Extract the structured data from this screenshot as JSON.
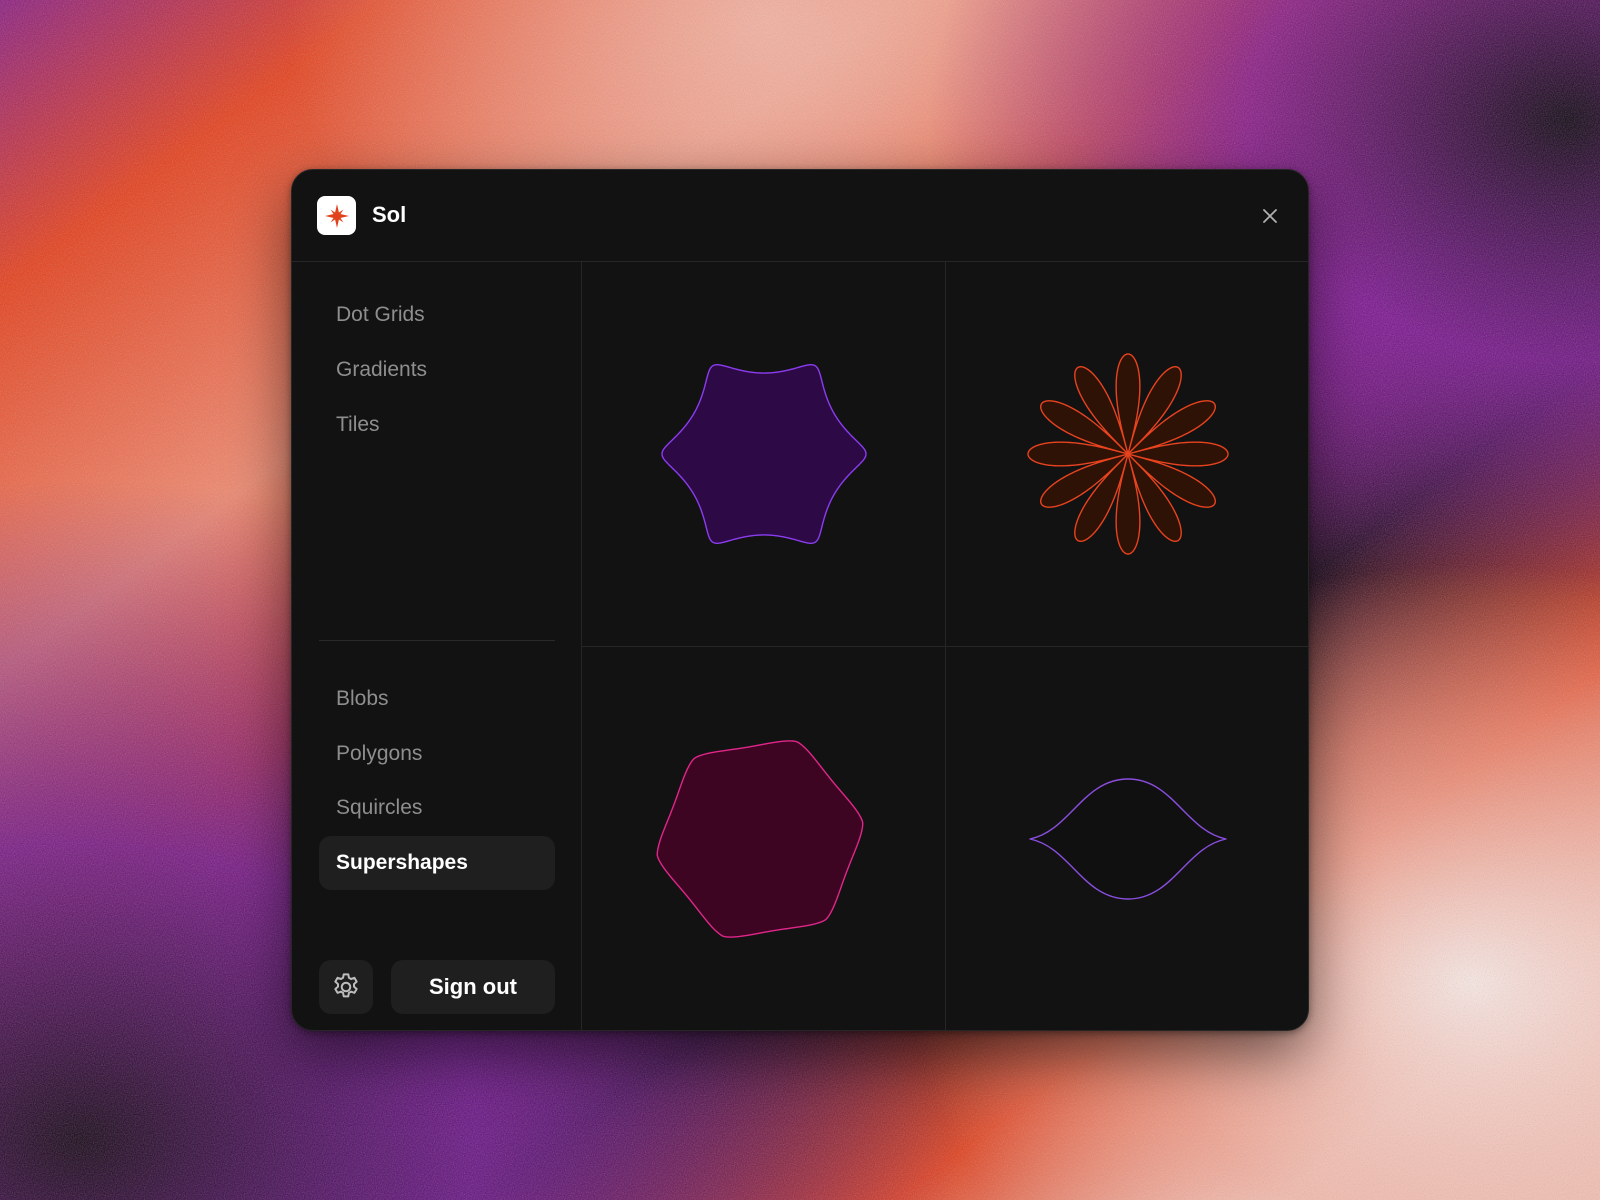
{
  "app": {
    "title": "Sol",
    "logo_icon": "sparkle-star-icon",
    "logo_color": "#e0421c"
  },
  "sidebar": {
    "groups": [
      [
        "Dot Grids",
        "Gradients",
        "Tiles"
      ],
      [
        "Blobs",
        "Polygons",
        "Squircles",
        "Supershapes"
      ]
    ],
    "items": [
      {
        "label": "Dot Grids",
        "active": false
      },
      {
        "label": "Gradients",
        "active": false
      },
      {
        "label": "Tiles",
        "active": false
      },
      {
        "label": "Blobs",
        "active": false
      },
      {
        "label": "Polygons",
        "active": false
      },
      {
        "label": "Squircles",
        "active": false
      },
      {
        "label": "Supershapes",
        "active": true
      }
    ],
    "settings_icon": "gear-icon",
    "signout_label": "Sign out"
  },
  "window": {
    "close_icon": "close-icon"
  },
  "shapes": [
    {
      "kind": "hexagon-supershape",
      "stroke": "#8b3cf0",
      "fill": "#2d0a45"
    },
    {
      "kind": "twelve-petal-flower-supershape",
      "stroke": "#e8431f",
      "fill": "#2e1206"
    },
    {
      "kind": "six-point-star-supershape",
      "stroke": "#e0268a",
      "fill": "#3d0522"
    },
    {
      "kind": "lens-supershape",
      "stroke": "#8b4ee0",
      "fill": "#101010"
    }
  ],
  "colors": {
    "window_bg": "#121212",
    "accent_orange": "#e8431f",
    "accent_purple": "#7d1a9e",
    "backdrop_light": "#f7e0dc"
  }
}
